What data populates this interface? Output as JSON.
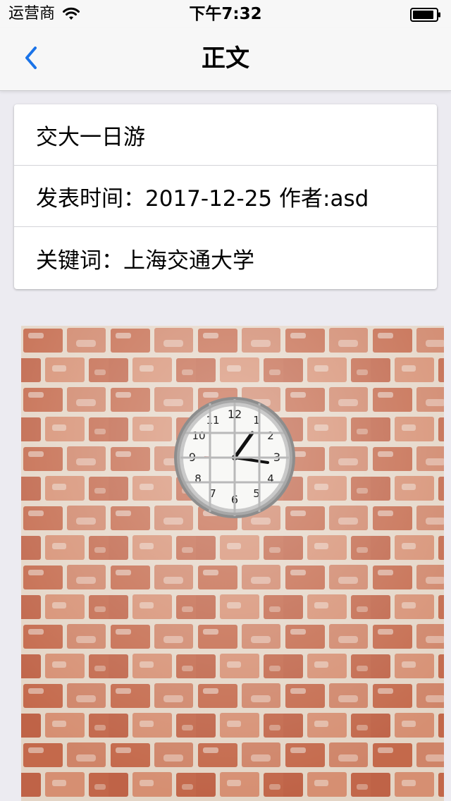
{
  "status_bar": {
    "carrier": "运营商",
    "time": "下午7:32",
    "icons": [
      "wifi-icon",
      "battery-icon"
    ]
  },
  "nav": {
    "title": "正文",
    "back_icon": "chevron-left-icon"
  },
  "article": {
    "title": "交大一日游",
    "meta": "发表时间：2017-12-25 作者:asd",
    "keywords": "关键词：上海交通大学"
  },
  "image": {
    "subject": "wall clock on brick wall"
  },
  "colors": {
    "accent": "#1a73e8",
    "background": "#ecebf1",
    "bar": "#f7f7f7",
    "brick": "#c0664a",
    "mortar": "#e6d6c8"
  }
}
